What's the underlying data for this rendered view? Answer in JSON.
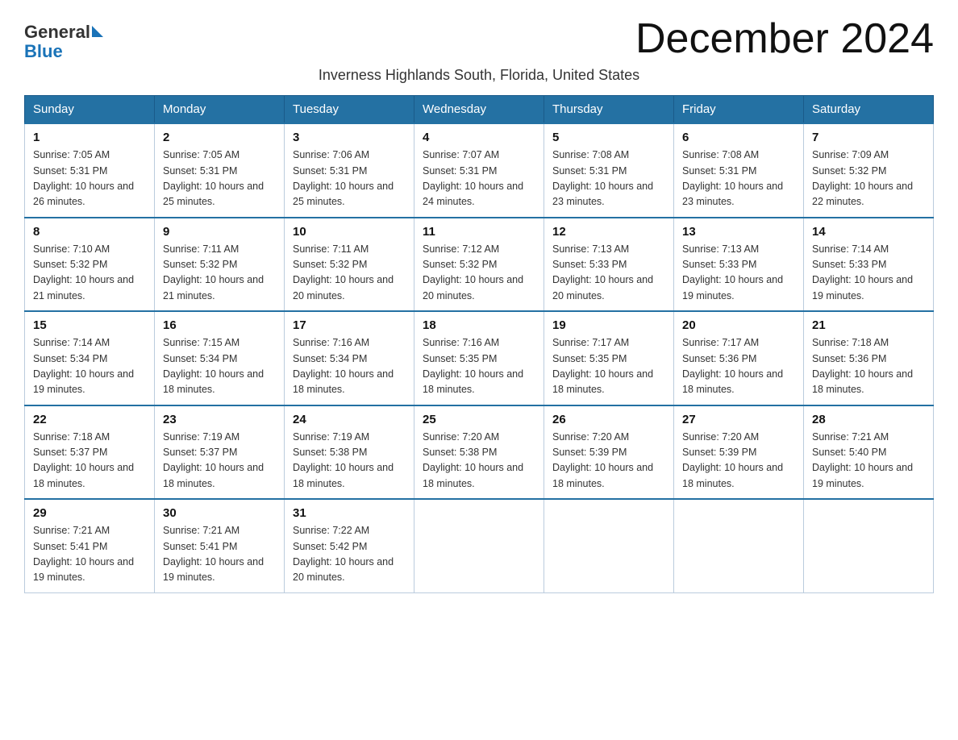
{
  "header": {
    "logo_general": "General",
    "logo_blue": "Blue",
    "title": "December 2024",
    "subtitle": "Inverness Highlands South, Florida, United States"
  },
  "days_of_week": [
    "Sunday",
    "Monday",
    "Tuesday",
    "Wednesday",
    "Thursday",
    "Friday",
    "Saturday"
  ],
  "weeks": [
    [
      {
        "day": "1",
        "sunrise": "7:05 AM",
        "sunset": "5:31 PM",
        "daylight": "10 hours and 26 minutes."
      },
      {
        "day": "2",
        "sunrise": "7:05 AM",
        "sunset": "5:31 PM",
        "daylight": "10 hours and 25 minutes."
      },
      {
        "day": "3",
        "sunrise": "7:06 AM",
        "sunset": "5:31 PM",
        "daylight": "10 hours and 25 minutes."
      },
      {
        "day": "4",
        "sunrise": "7:07 AM",
        "sunset": "5:31 PM",
        "daylight": "10 hours and 24 minutes."
      },
      {
        "day": "5",
        "sunrise": "7:08 AM",
        "sunset": "5:31 PM",
        "daylight": "10 hours and 23 minutes."
      },
      {
        "day": "6",
        "sunrise": "7:08 AM",
        "sunset": "5:31 PM",
        "daylight": "10 hours and 23 minutes."
      },
      {
        "day": "7",
        "sunrise": "7:09 AM",
        "sunset": "5:32 PM",
        "daylight": "10 hours and 22 minutes."
      }
    ],
    [
      {
        "day": "8",
        "sunrise": "7:10 AM",
        "sunset": "5:32 PM",
        "daylight": "10 hours and 21 minutes."
      },
      {
        "day": "9",
        "sunrise": "7:11 AM",
        "sunset": "5:32 PM",
        "daylight": "10 hours and 21 minutes."
      },
      {
        "day": "10",
        "sunrise": "7:11 AM",
        "sunset": "5:32 PM",
        "daylight": "10 hours and 20 minutes."
      },
      {
        "day": "11",
        "sunrise": "7:12 AM",
        "sunset": "5:32 PM",
        "daylight": "10 hours and 20 minutes."
      },
      {
        "day": "12",
        "sunrise": "7:13 AM",
        "sunset": "5:33 PM",
        "daylight": "10 hours and 20 minutes."
      },
      {
        "day": "13",
        "sunrise": "7:13 AM",
        "sunset": "5:33 PM",
        "daylight": "10 hours and 19 minutes."
      },
      {
        "day": "14",
        "sunrise": "7:14 AM",
        "sunset": "5:33 PM",
        "daylight": "10 hours and 19 minutes."
      }
    ],
    [
      {
        "day": "15",
        "sunrise": "7:14 AM",
        "sunset": "5:34 PM",
        "daylight": "10 hours and 19 minutes."
      },
      {
        "day": "16",
        "sunrise": "7:15 AM",
        "sunset": "5:34 PM",
        "daylight": "10 hours and 18 minutes."
      },
      {
        "day": "17",
        "sunrise": "7:16 AM",
        "sunset": "5:34 PM",
        "daylight": "10 hours and 18 minutes."
      },
      {
        "day": "18",
        "sunrise": "7:16 AM",
        "sunset": "5:35 PM",
        "daylight": "10 hours and 18 minutes."
      },
      {
        "day": "19",
        "sunrise": "7:17 AM",
        "sunset": "5:35 PM",
        "daylight": "10 hours and 18 minutes."
      },
      {
        "day": "20",
        "sunrise": "7:17 AM",
        "sunset": "5:36 PM",
        "daylight": "10 hours and 18 minutes."
      },
      {
        "day": "21",
        "sunrise": "7:18 AM",
        "sunset": "5:36 PM",
        "daylight": "10 hours and 18 minutes."
      }
    ],
    [
      {
        "day": "22",
        "sunrise": "7:18 AM",
        "sunset": "5:37 PM",
        "daylight": "10 hours and 18 minutes."
      },
      {
        "day": "23",
        "sunrise": "7:19 AM",
        "sunset": "5:37 PM",
        "daylight": "10 hours and 18 minutes."
      },
      {
        "day": "24",
        "sunrise": "7:19 AM",
        "sunset": "5:38 PM",
        "daylight": "10 hours and 18 minutes."
      },
      {
        "day": "25",
        "sunrise": "7:20 AM",
        "sunset": "5:38 PM",
        "daylight": "10 hours and 18 minutes."
      },
      {
        "day": "26",
        "sunrise": "7:20 AM",
        "sunset": "5:39 PM",
        "daylight": "10 hours and 18 minutes."
      },
      {
        "day": "27",
        "sunrise": "7:20 AM",
        "sunset": "5:39 PM",
        "daylight": "10 hours and 18 minutes."
      },
      {
        "day": "28",
        "sunrise": "7:21 AM",
        "sunset": "5:40 PM",
        "daylight": "10 hours and 19 minutes."
      }
    ],
    [
      {
        "day": "29",
        "sunrise": "7:21 AM",
        "sunset": "5:41 PM",
        "daylight": "10 hours and 19 minutes."
      },
      {
        "day": "30",
        "sunrise": "7:21 AM",
        "sunset": "5:41 PM",
        "daylight": "10 hours and 19 minutes."
      },
      {
        "day": "31",
        "sunrise": "7:22 AM",
        "sunset": "5:42 PM",
        "daylight": "10 hours and 20 minutes."
      },
      null,
      null,
      null,
      null
    ]
  ],
  "labels": {
    "sunrise_prefix": "Sunrise: ",
    "sunset_prefix": "Sunset: ",
    "daylight_prefix": "Daylight: "
  }
}
